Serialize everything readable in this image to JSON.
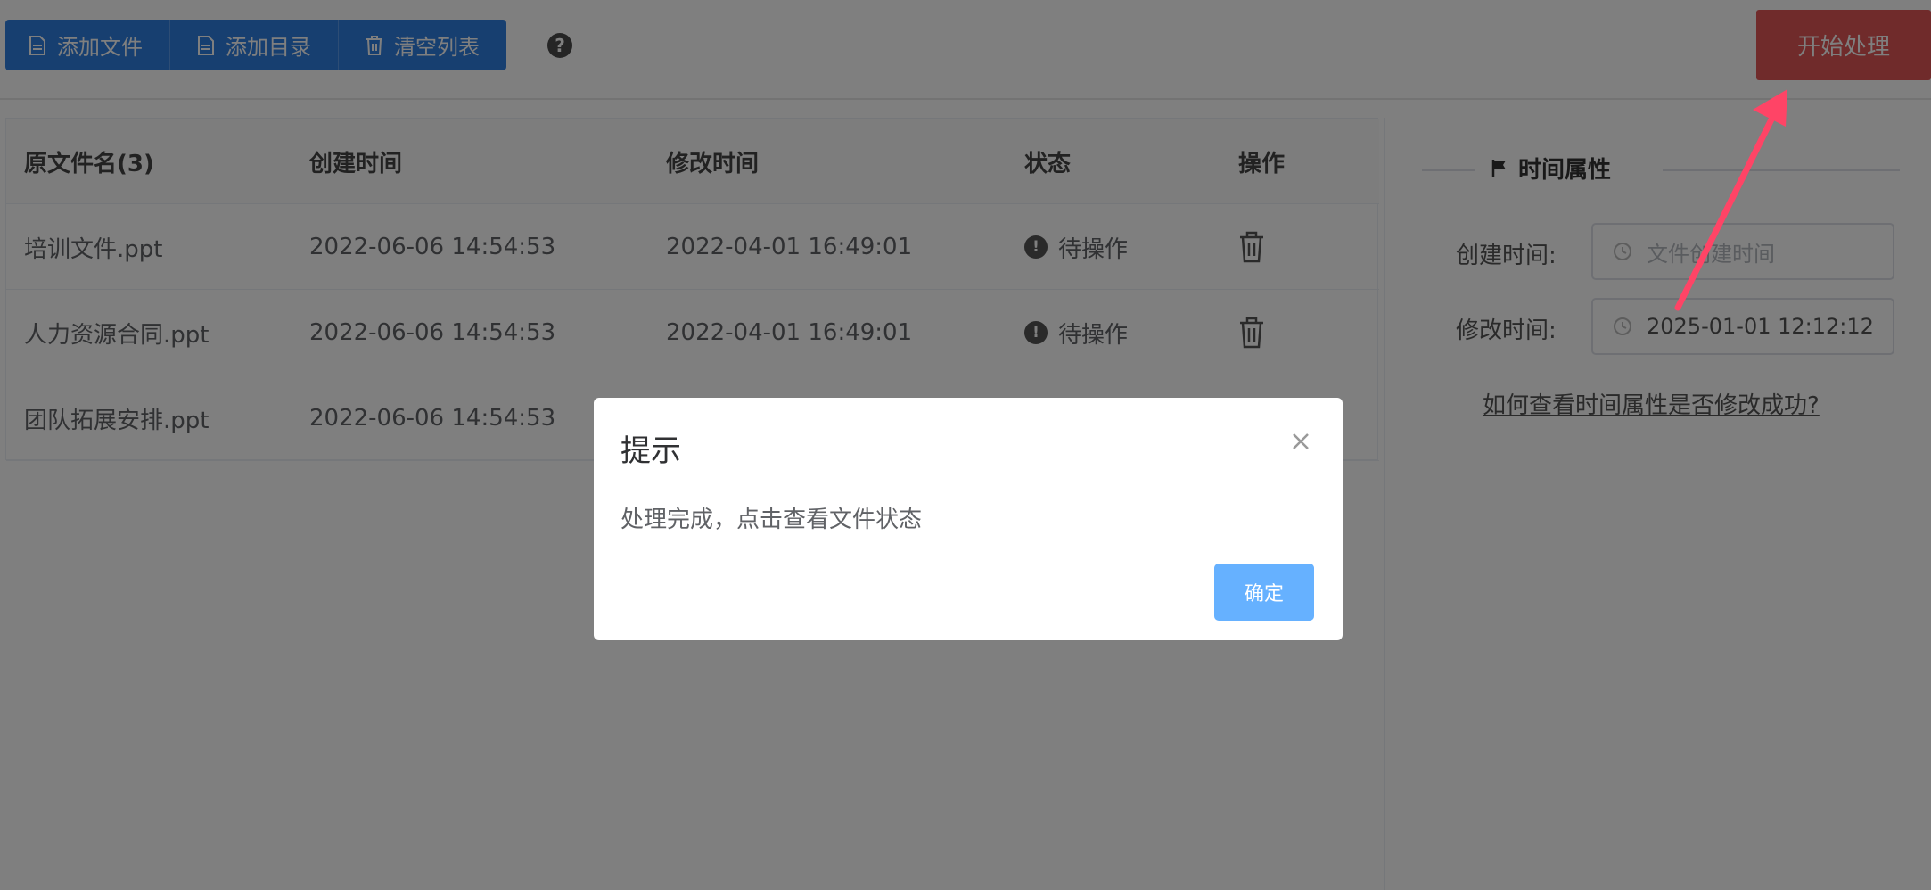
{
  "toolbar": {
    "add_file": "添加文件",
    "add_dir": "添加目录",
    "clear_list": "清空列表",
    "help": "?",
    "start": "开始处理"
  },
  "table": {
    "headers": [
      "原文件名(3)",
      "创建时间",
      "修改时间",
      "状态",
      "操作"
    ],
    "rows": [
      {
        "name": "培训文件.ppt",
        "created": "2022-06-06 14:54:53",
        "modified": "2022-04-01 16:49:01",
        "status": "待操作"
      },
      {
        "name": "人力资源合同.ppt",
        "created": "2022-06-06 14:54:53",
        "modified": "2022-04-01 16:49:01",
        "status": "待操作"
      },
      {
        "name": "团队拓展安排.ppt",
        "created": "2022-06-06 14:54:53"
      }
    ]
  },
  "panel": {
    "title": "时间属性",
    "created_label": "创建时间:",
    "created_placeholder": "文件创建时间",
    "modified_label": "修改时间:",
    "modified_value": "2025-01-01 12:12:12",
    "help_link": "如何查看时间属性是否修改成功?"
  },
  "dialog": {
    "title": "提示",
    "message": "处理完成，点击查看文件状态",
    "ok": "确定"
  },
  "colors": {
    "primary": "#2f7fe0",
    "start": "#e05757",
    "ok": "#66b1ff",
    "arrow": "#ff4466"
  }
}
